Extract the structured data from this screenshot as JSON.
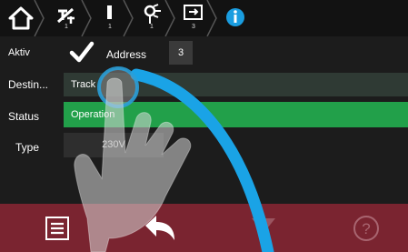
{
  "breadcrumb": {
    "items": [
      {
        "icon": "home-icon",
        "glyph": "⌂",
        "number": ""
      },
      {
        "icon": "signal-slash-icon",
        "glyph": "✗",
        "number": "1"
      },
      {
        "icon": "exclamation-icon",
        "glyph": "!",
        "number": "1"
      },
      {
        "icon": "signal-lamp-icon",
        "glyph": "ϙ",
        "number": "1"
      },
      {
        "icon": "exit-box-icon",
        "glyph": "⇥",
        "number": "3"
      },
      {
        "icon": "info-icon",
        "glyph": "i",
        "number": ""
      }
    ]
  },
  "form": {
    "aktiv_label": "Aktiv",
    "aktiv_checked": true,
    "address_label": "Address",
    "address_value": "3",
    "destination_label": "Destin...",
    "destination_value": "Track",
    "status_label": "Status",
    "status_value": "Operation",
    "type_label": "Type",
    "type_value": "230V"
  },
  "footer": {
    "menu_icon": "menu-list-icon",
    "back_icon": "back-arrow-icon",
    "down_icon": "down-triangle-icon",
    "help_icon": "help-icon"
  },
  "colors": {
    "status_green": "#22a04a",
    "footer_red": "#7a2430",
    "info_blue": "#1a9de0",
    "swipe_blue": "#1aa3e6"
  }
}
